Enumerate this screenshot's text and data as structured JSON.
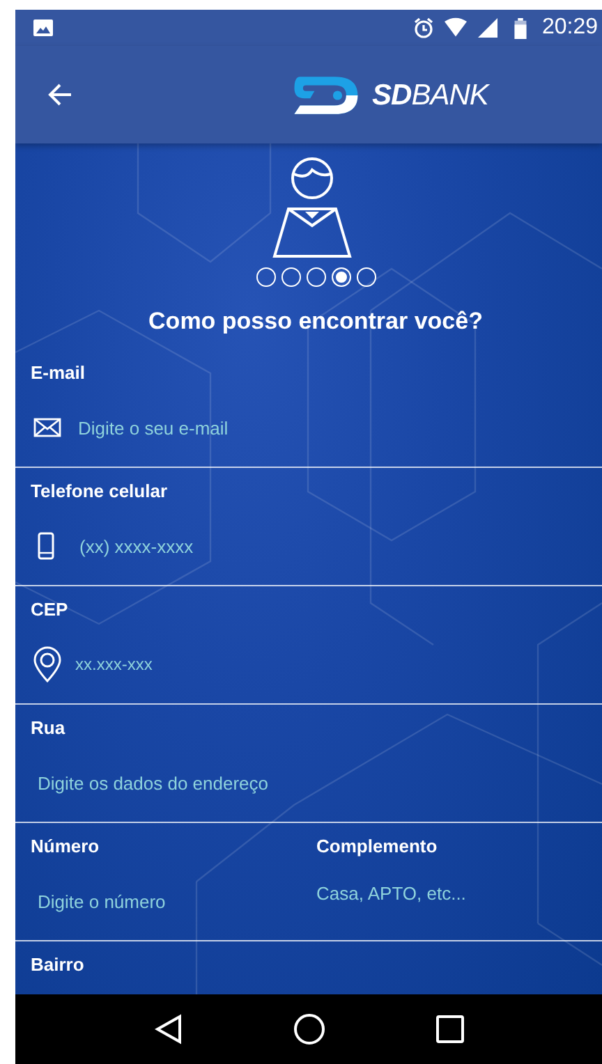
{
  "status_bar": {
    "time": "20:29"
  },
  "app_bar": {
    "brand": "**SD**BANK"
  },
  "steps": [
    {
      "selected": false
    },
    {
      "selected": false
    },
    {
      "selected": false
    },
    {
      "selected": true
    },
    {
      "selected": false
    }
  ],
  "title": "Como posso encontrar você?",
  "fields": [
    {
      "label": "E-mail",
      "placeholder": "Digite o seu e-mail",
      "kind": "email"
    },
    {
      "label": "Telefone celular",
      "placeholder": "(xx) xxxx-xxxx",
      "kind": "phone"
    },
    {
      "label": "CEP",
      "placeholder": "xx.xxx-xxx",
      "kind": "location"
    },
    {
      "label": "Rua",
      "placeholder": "Digite os dados do endereço",
      "kind": "plain"
    }
  ],
  "pair": [
    {
      "label": "Número",
      "placeholder": "Digite o número"
    },
    {
      "label": "Complemento",
      "placeholder": "Casa, APTO, etc..."
    }
  ],
  "last_label": "Bairro"
}
